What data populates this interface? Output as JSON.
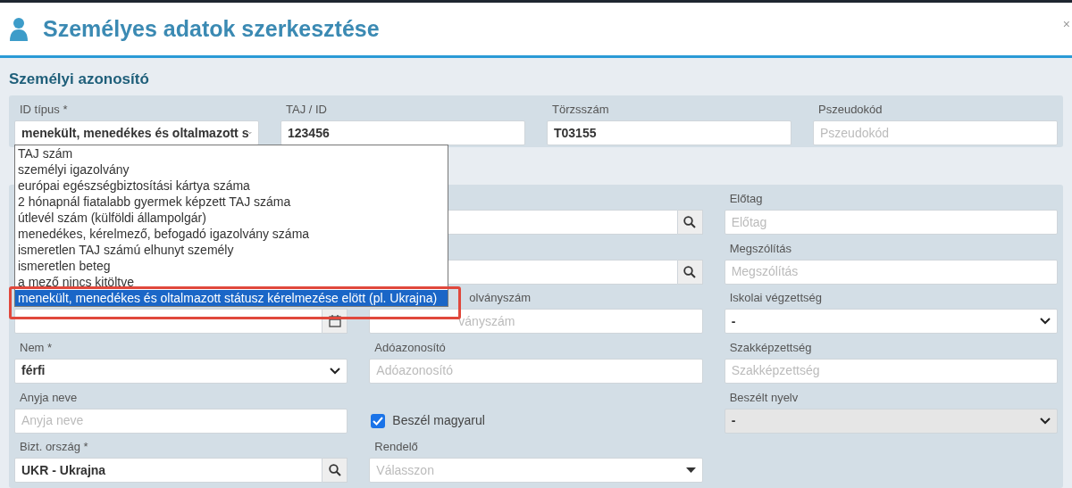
{
  "dialog": {
    "title": "Személyes adatok szerkesztése",
    "close": "×"
  },
  "sections": [
    {
      "title": "Személyi azonosító",
      "fields": [
        {
          "kind": "select",
          "label": "ID típus *",
          "value": "menekült, menedékes és oltalmazott s"
        },
        {
          "kind": "text",
          "label": "TAJ / ID",
          "value": "123456"
        },
        {
          "kind": "text",
          "label": "Törzsszám",
          "value": "T03155"
        },
        {
          "kind": "text",
          "label": "Pszeudokód",
          "placeholder": "Pszeudokód"
        }
      ]
    },
    {
      "fields": [
        {
          "kind": "blank"
        },
        {
          "kind": "search"
        },
        {
          "kind": "text",
          "label": "Előtag",
          "placeholder": "Előtag"
        },
        {
          "kind": "blank"
        },
        {
          "kind": "search"
        },
        {
          "kind": "text",
          "label": "Megszólítás",
          "placeholder": "Megszólítás"
        },
        {
          "kind": "date"
        },
        {
          "kind": "tail_text",
          "label": "olványszám",
          "placeholder": "ványszám"
        },
        {
          "kind": "select",
          "label": "Iskolai végzettség",
          "value": "-"
        },
        {
          "kind": "select",
          "label": "Nem *",
          "value": "férfi"
        },
        {
          "kind": "text",
          "label": "Adóazonosító",
          "placeholder": "Adóazonosító"
        },
        {
          "kind": "text",
          "label": "Szakképzettség",
          "placeholder": "Szakképzettség"
        },
        {
          "kind": "text",
          "label": "Anyja neve",
          "placeholder": "Anyja neve"
        },
        {
          "kind": "checkbox",
          "label": "Beszél magyarul",
          "checked": true
        },
        {
          "kind": "select",
          "label": "Beszélt nyelv",
          "value": "-",
          "disabled": true
        },
        {
          "kind": "search",
          "label": "Bizt. ország *",
          "value": "UKR - Ukrajna"
        },
        {
          "kind": "dropdown",
          "label": "Rendelő",
          "placeholder": "Válasszon"
        },
        {
          "kind": "blank"
        }
      ]
    }
  ],
  "open_list": {
    "options": [
      {
        "label": "TAJ szám",
        "selected": false
      },
      {
        "label": "személyi igazolvány",
        "selected": false
      },
      {
        "label": "európai egészségbiztosítási kártya száma",
        "selected": false
      },
      {
        "label": "2 hónapnál fiatalabb gyermek képzett TAJ száma",
        "selected": false
      },
      {
        "label": "útlevél szám (külföldi állampolgár)",
        "selected": false
      },
      {
        "label": "menedékes, kérelmező, befogadó igazolvány száma",
        "selected": false
      },
      {
        "label": "ismeretlen TAJ számú elhunyt személy",
        "selected": false
      },
      {
        "label": "ismeretlen beteg",
        "selected": false
      },
      {
        "label": "a mező nincs kitöltve",
        "selected": false
      },
      {
        "label": "menekült, menedékes és oltalmazott státusz kérelmezése elött (pl. Ukrajna)",
        "selected": true
      }
    ],
    "highlighted": true
  }
}
